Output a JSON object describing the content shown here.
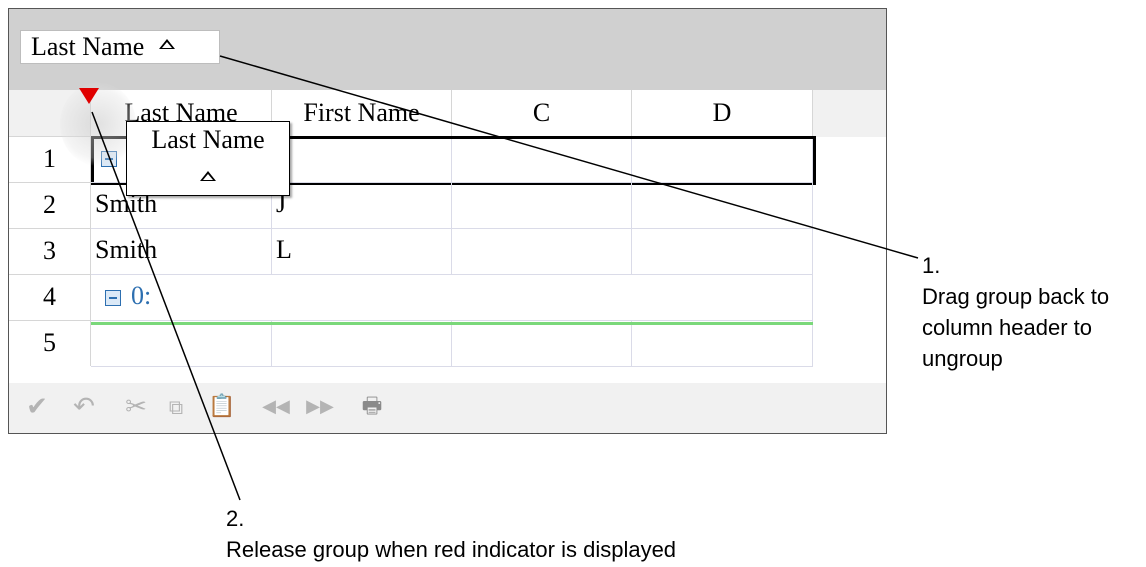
{
  "group_panel": {
    "chip_label": "Last Name"
  },
  "columns": [
    "Last Name",
    "First Name",
    "C",
    "D"
  ],
  "rows": [
    {
      "num": "1",
      "cells": [
        "",
        "",
        "",
        ""
      ]
    },
    {
      "num": "2",
      "cells": [
        "Smith",
        "J",
        "",
        ""
      ]
    },
    {
      "num": "3",
      "cells": [
        "Smith",
        "L",
        "",
        ""
      ]
    },
    {
      "num": "4",
      "group_label": "0:"
    },
    {
      "num": "5",
      "cells": [
        "",
        "",
        "",
        ""
      ]
    }
  ],
  "drag_proxy": {
    "label": "Last Name"
  },
  "toolbar": {
    "icons": [
      "checkmark-icon",
      "undo-icon",
      "cut-icon",
      "copy-icon",
      "paste-icon",
      "previous-icon",
      "next-icon",
      "print-icon"
    ]
  },
  "callouts": {
    "one": {
      "number": "1.",
      "lines": [
        "Drag group back to",
        "column header to",
        "ungroup"
      ]
    },
    "two": {
      "number": "2.",
      "text": "Release group when red indicator is displayed"
    }
  },
  "colors": {
    "indicator": "#e00000",
    "group_panel": "#d0d0d0",
    "group_text": "#2d6fb0",
    "drop_line": "#7ad87a"
  }
}
